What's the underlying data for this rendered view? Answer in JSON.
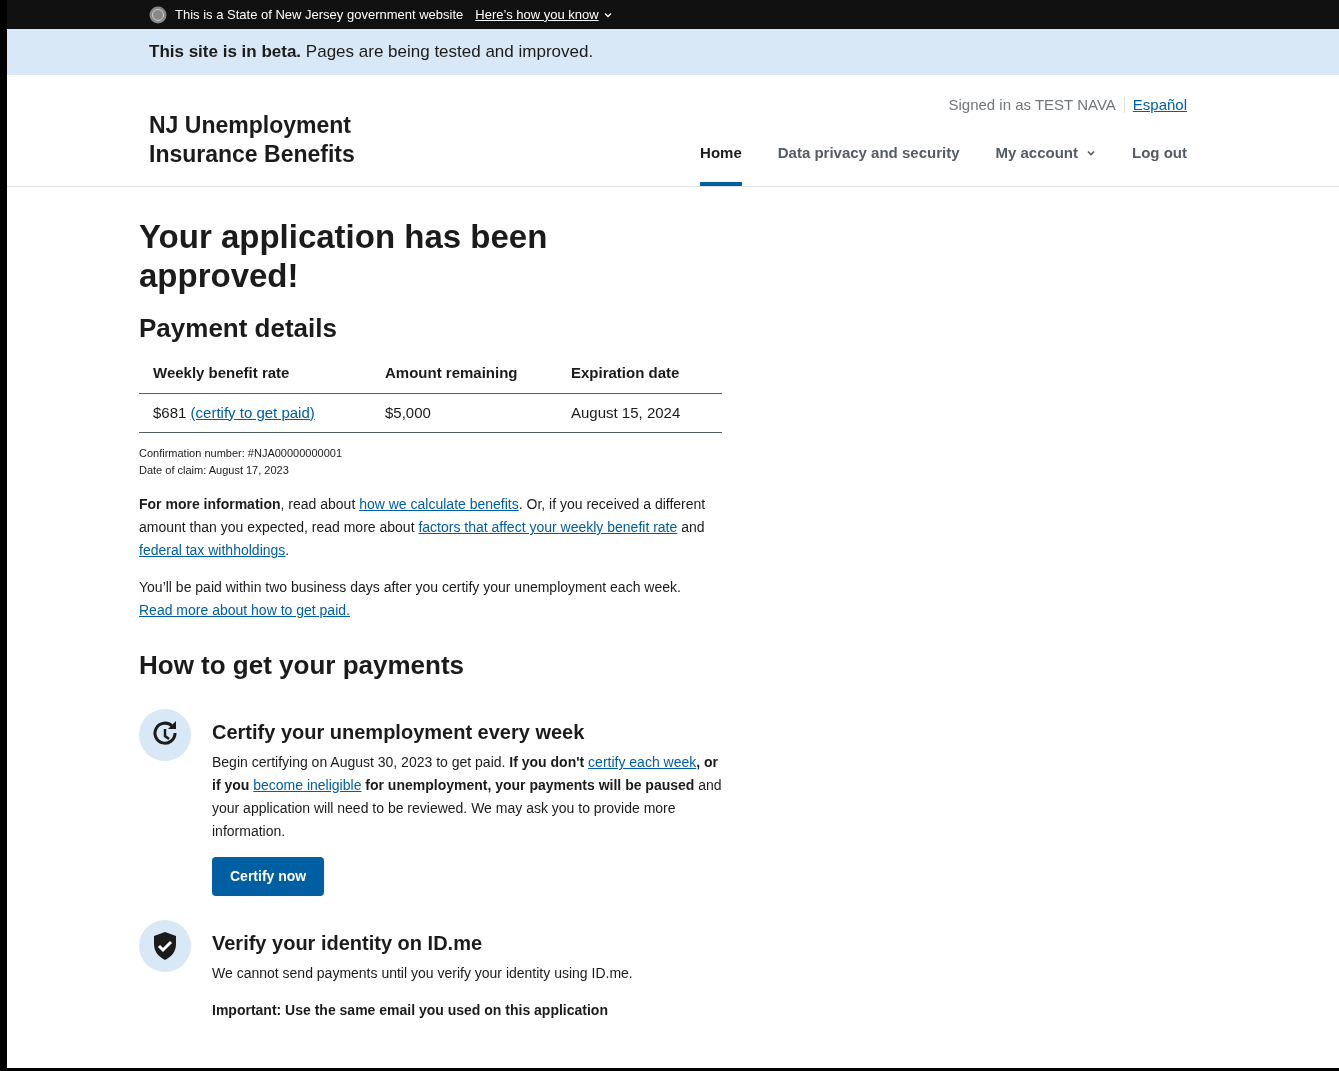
{
  "gov_banner": {
    "text": "This is a State of New Jersey government website",
    "link": "Here’s how you know"
  },
  "beta_banner": {
    "bold": "This site is in beta.",
    "text": "Pages are being tested and improved."
  },
  "header": {
    "title_lines": [
      "NJ Unemployment",
      "Insurance Benefits"
    ],
    "signed_in": "Signed in as TEST NAVA",
    "language_link": "Español",
    "nav": [
      {
        "label": "Home",
        "selected": true,
        "kind": "link"
      },
      {
        "label": "Data privacy and security",
        "selected": false,
        "kind": "link"
      },
      {
        "label": "My account",
        "selected": false,
        "kind": "dropdown"
      },
      {
        "label": "Log out",
        "selected": false,
        "kind": "link"
      }
    ]
  },
  "heading": "Your application has been approved!",
  "payment_details": {
    "heading": "Payment details",
    "columns": [
      "Weekly benefit rate",
      "Amount remaining",
      "Expiration date"
    ],
    "row": {
      "rate": "$681",
      "rate_link": "(certify to get paid)",
      "amount": "$5,000",
      "expiration": "August 15, 2024"
    },
    "notes": [
      "Confirmation number: #NJA00000000001",
      "Date of claim: August 17, 2023"
    ]
  },
  "paragraphs": [
    [
      {
        "kind": "bold",
        "text": "For more information"
      },
      {
        "kind": "text",
        "text": ", read about "
      },
      {
        "kind": "link",
        "text": "how we calculate benefits"
      },
      {
        "kind": "text",
        "text": ". Or, if you received a different amount than you expected, read more about "
      },
      {
        "kind": "link",
        "text": "factors that affect your weekly benefit rate"
      },
      {
        "kind": "text",
        "text": " and "
      },
      {
        "kind": "link",
        "text": "federal tax withholdings"
      },
      {
        "kind": "text",
        "text": "."
      }
    ],
    [
      {
        "kind": "text",
        "text": "You’ll be paid within two business days after you certify your unemployment each week. "
      },
      {
        "kind": "link",
        "text": "Read more about how to get paid."
      }
    ]
  ],
  "payments": {
    "heading": "How to get your payments",
    "steps": [
      {
        "kind": "certify",
        "title": "Certify your unemployment every week",
        "body": [
          [
            {
              "kind": "text",
              "text": "Begin certifying on August 30, 2023 to get paid. "
            },
            {
              "kind": "bold",
              "text": "If you don't "
            },
            {
              "kind": "link",
              "text": "certify each week"
            },
            {
              "kind": "bold",
              "text": ", or if you "
            },
            {
              "kind": "link",
              "text": "become ineligible"
            },
            {
              "kind": "bold",
              "text": " for unemployment, your payments will be paused"
            },
            {
              "kind": "text",
              "text": " and your application will need to be reviewed. We may ask you to provide more information."
            }
          ]
        ],
        "button": "Certify now"
      },
      {
        "kind": "verify",
        "title": "Verify your identity on ID.me",
        "body": [
          [
            {
              "kind": "text",
              "text": "We cannot send payments until you verify your identity using ID.me."
            }
          ],
          [
            {
              "kind": "bold",
              "text": "Important: Use the same email you used on this application"
            }
          ]
        ]
      }
    ]
  }
}
